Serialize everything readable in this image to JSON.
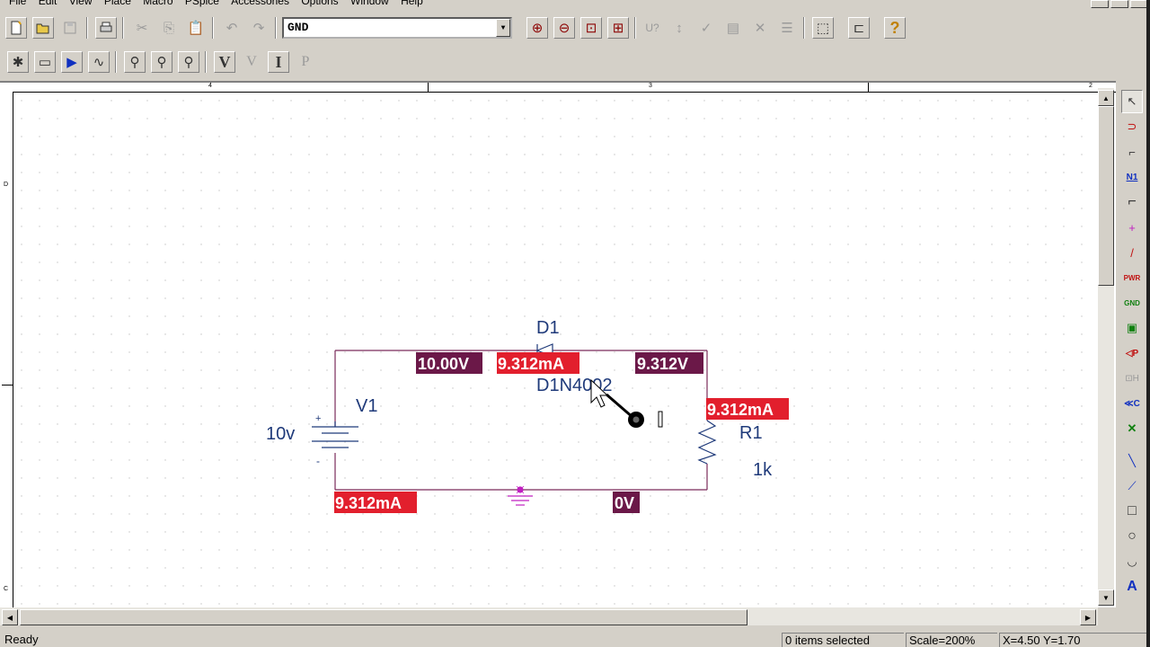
{
  "menu": [
    "File",
    "Edit",
    "View",
    "Place",
    "Macro",
    "PSpice",
    "Accessories",
    "Options",
    "Window",
    "Help"
  ],
  "toolbar": {
    "net_combo_value": "GND",
    "dropdown_arrow": "▼",
    "row1_icons": [
      "new-file-icon",
      "open-folder-icon",
      "save-icon",
      "print-icon",
      "cut-icon",
      "copy-icon",
      "paste-icon",
      "undo-icon",
      "redo-icon"
    ],
    "row1_right_icons": [
      "zoom-in-icon",
      "zoom-out-icon",
      "zoom-area-icon",
      "zoom-all-icon",
      "annotate-icon",
      "back-annotate-icon",
      "drc-icon",
      "netlist-icon",
      "cross-reference-icon",
      "bill-of-materials-icon",
      "browse-icon",
      "hierarchy-icon",
      "help-icon"
    ],
    "row1_right_glyphs": [
      "⊕",
      "⊖",
      "⊡",
      "⊞",
      "U?",
      "↕",
      "✓",
      "▤",
      "✕",
      "☰",
      "⬚",
      "⊏",
      "?"
    ],
    "row2_icons": [
      "new-simulation-icon",
      "edit-simulation-icon",
      "run-simulation-icon",
      "view-results-icon",
      "markers-icon",
      "voltage-probe-icon",
      "current-probe-icon",
      "bias-voltage-icon",
      "bias-voltage-level-icon",
      "bias-current-icon",
      "bias-power-icon"
    ],
    "row2_glyphs": [
      "✱",
      "▭",
      "▶",
      "∿",
      "⚲",
      "⚲",
      "⚲",
      "V",
      "V",
      "I",
      "P"
    ],
    "help_glyph": "?"
  },
  "schematic": {
    "components": {
      "d1_ref": "D1",
      "d1_part": "D1N4002",
      "v1_ref": "V1",
      "v1_value": "10v",
      "r1_ref": "R1",
      "r1_value": "1k",
      "plus_sign": "+",
      "minus_sign": "-"
    },
    "markers": {
      "v_node_top_left": "10.00V",
      "i_diode": "9.312mA",
      "v_node_top_right": "9.312V",
      "i_resistor": "9.312mA",
      "i_source": "9.312mA",
      "v_ground": "0V"
    },
    "ruler_top": [
      "4",
      "3",
      "2"
    ],
    "ruler_left": [
      "D",
      "C"
    ]
  },
  "palette_icons": [
    "select-icon",
    "place-part-icon",
    "place-wire-icon",
    "net-alias-icon",
    "place-bus-icon",
    "junction-icon",
    "bus-entry-icon",
    "power-icon",
    "ground-icon",
    "hierarchical-block-icon",
    "port-icon",
    "hierarchical-pin-icon",
    "off-page-connector-icon",
    "no-connect-icon",
    "line-icon",
    "polyline-icon",
    "rectangle-icon",
    "ellipse-icon",
    "arc-icon",
    "text-icon"
  ],
  "palette_glyphs": [
    "↖",
    "⊃",
    "⌐",
    "N1",
    "⌐",
    "+",
    "/",
    "PWR",
    "GND",
    "▣",
    "◁P",
    "⊡H",
    "≪C",
    "✕",
    "╲",
    "⟋",
    "□",
    "○",
    "◡",
    "A"
  ],
  "status": {
    "ready": "Ready",
    "items_selected": "0 items selected",
    "scale": "Scale=200%",
    "coords": "X=4.50  Y=1.70"
  },
  "colors": {
    "voltage_marker": "#6b1848",
    "current_marker": "#e21f2d",
    "wire": "#7a2a5a",
    "component_text": "#1f3a7a",
    "ground": "#c020c0"
  }
}
